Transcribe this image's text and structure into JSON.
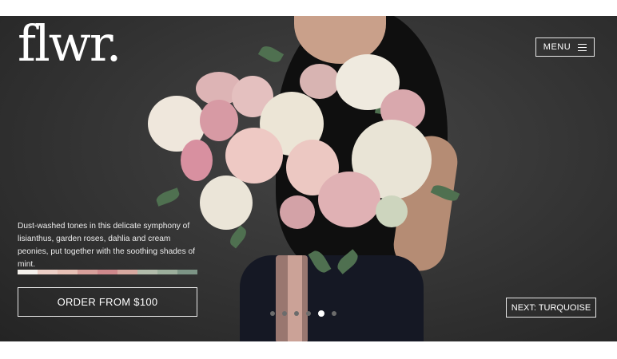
{
  "header": {
    "logo_text": "flwr.",
    "menu_label": "MENU"
  },
  "hero": {
    "description": "Dust-washed tones in this delicate symphony of lisianthus, garden roses, dahlia and cream peonies, put together with the soothing shades of mint.",
    "palette": [
      "#f4f1ec",
      "#eccfc6",
      "#e7c0b5",
      "#d8a09b",
      "#cf898c",
      "#d7a9a0",
      "#b2bcab",
      "#9caf9c",
      "#7d9586"
    ],
    "order_label": "ORDER FROM $100",
    "next_label": "NEXT: TURQUOISE",
    "slides": {
      "count": 6,
      "active_index": 4
    }
  }
}
